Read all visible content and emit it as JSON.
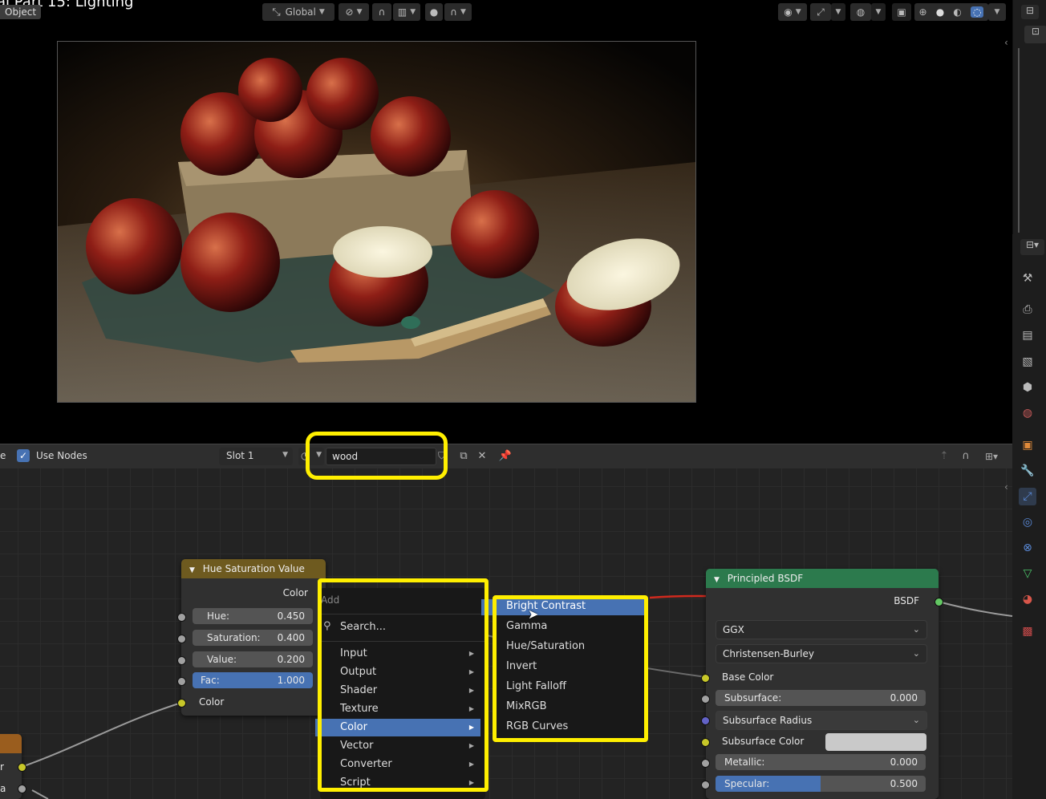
{
  "viewport": {
    "title": "al Part 15: Lighting",
    "mode_label": "Object",
    "orientation_label": "Global"
  },
  "node_header": {
    "partial_label": "e",
    "use_nodes_label": "Use Nodes",
    "slot_label": "Slot 1",
    "material_name": "wood"
  },
  "hue_node": {
    "title": "Hue Saturation Value",
    "output_color": "Color",
    "fields": [
      {
        "label": "Hue:",
        "value": "0.450"
      },
      {
        "label": "Saturation:",
        "value": "0.400"
      },
      {
        "label": "Value:",
        "value": "0.200"
      },
      {
        "label": "Fac:",
        "value": "1.000"
      }
    ],
    "input_color": "Color"
  },
  "left_node": {
    "row1": "r",
    "row2": "a"
  },
  "add_menu": {
    "title": "Add",
    "search": "Search...",
    "items": [
      "Input",
      "Output",
      "Shader",
      "Texture",
      "Color",
      "Vector",
      "Converter",
      "Script"
    ],
    "active_item": "Color"
  },
  "color_submenu": {
    "items": [
      "Bright Contrast",
      "Gamma",
      "Hue/Saturation",
      "Invert",
      "Light Falloff",
      "MixRGB",
      "RGB Curves"
    ],
    "active_item": "Bright Contrast"
  },
  "bsdf_node": {
    "title": "Principled BSDF",
    "output": "BSDF",
    "distribution": "GGX",
    "subsurface_method": "Christensen-Burley",
    "base_color_label": "Base Color",
    "subsurface_label": "Subsurface:",
    "subsurface_value": "0.000",
    "subsurface_radius_label": "Subsurface Radius",
    "subsurface_color_label": "Subsurface Color",
    "metallic_label": "Metallic:",
    "metallic_value": "0.000",
    "specular_label": "Specular:",
    "specular_value": "0.500",
    "specular_fraction": 0.5
  },
  "colors": {
    "accent_blue": "#4772b3",
    "highlight_yellow": "#ffef00",
    "hue_node_header": "#6e5a1f",
    "bsdf_node_header": "#2c7a4d",
    "socket_yellow": "#c7c729",
    "socket_green": "#63c763",
    "socket_grey": "#a1a1a1",
    "socket_blue": "#6363c7"
  }
}
